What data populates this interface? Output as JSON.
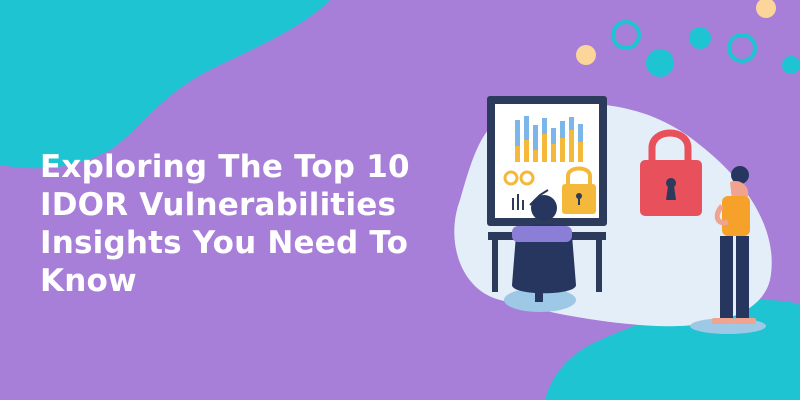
{
  "banner": {
    "headline_lines": [
      "Exploring The Top 10",
      "IDOR Vulnerabilities",
      "Insights You Need To",
      "Know"
    ]
  },
  "illustration": {
    "icons": [
      "padlock-icon",
      "padlock-icon",
      "monitor-icon",
      "person-icon"
    ]
  },
  "colors": {
    "background": "#a77fd8",
    "teal": "#1fc4d2",
    "cloud": "#e4eef8",
    "monitor_frame": "#2c3a5c",
    "lock_red": "#e8505b",
    "lock_yellow": "#f4b93a",
    "accent_peach": "#fbd59a",
    "shirt": "#f6a12a",
    "pants": "#27365e"
  }
}
